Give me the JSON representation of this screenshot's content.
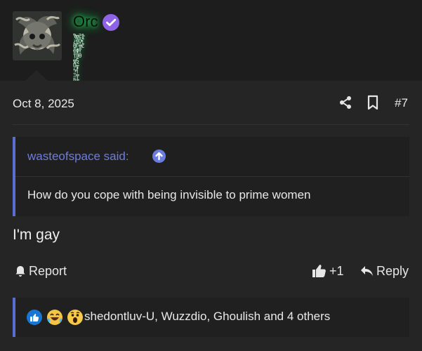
{
  "header": {
    "username": "Orc",
    "glitch_lines": [
      "Ϡ╦Ƨ╠",
      "¿╣Ỗ╕",
      "ΘΓ╪Ȼ",
      "╣ΦΫ",
      "ᴉ╠Ɵ",
      "╦Ȿ",
      "Ǖ╥",
      "ϟ╡",
      "Ξ╤",
      "Ϸ╞",
      "ƺ╨",
      "ʮ╔"
    ]
  },
  "post": {
    "date": "Oct 8, 2025",
    "post_number": "#7",
    "quote_author": "wasteofspace said:",
    "quote_text": "How do you cope with being invisible to prime women",
    "body": "I'm gay"
  },
  "actions": {
    "report": "Report",
    "like_count": "+1",
    "reply": "Reply"
  },
  "reactions": {
    "summary": "shedontluv-U, Wuzzdio, Ghoulish and 4 others",
    "icons": [
      "like-reaction-icon",
      "laugh-reaction-icon",
      "wow-reaction-icon"
    ]
  },
  "colors": {
    "background": "#1d1d1d",
    "post_background": "#252525",
    "accent": "#6c7de0",
    "quote_border": "#5a6ed1",
    "verified": "#8e63e6",
    "glow": "#23d05a"
  }
}
